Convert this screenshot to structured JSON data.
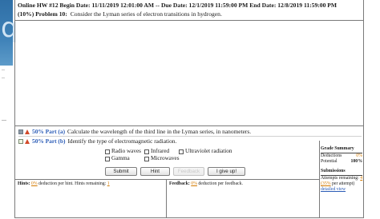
{
  "header": {
    "title_line": "Online HW #12 Begin Date: 11/11/2019 12:01:00 AM -- Due Date: 12/1/2019 11:59:00 PM End Date: 12/8/2019 11:59:00 PM",
    "problem_pct": "(10%)",
    "problem_label": "Problem 10:",
    "problem_text": "Consider the Lyman series of electron transitions in hydrogen."
  },
  "parts": [
    {
      "tag": "50% Part (a)",
      "text": "Calculate the wavelength of the third line in the Lyman series, in nanometers."
    },
    {
      "tag": "50% Part (b)",
      "text": "Identify the type of electromagnetic radiation."
    }
  ],
  "answers": [
    "Radio waves",
    "Infrared",
    "Ultraviolet radiation",
    "Gamma",
    "Microwaves"
  ],
  "buttons": {
    "submit": "Submit",
    "hint": "Hint",
    "feedback": "Feedback",
    "give_up": "I give up!"
  },
  "grade_summary": {
    "title": "Grade Summary",
    "deductions_label": "Deductions",
    "deductions_value": "0%",
    "potential_label": "Potential",
    "potential_value": "100%"
  },
  "submissions": {
    "title": "Submissions",
    "attempts_label": "Attempts remaining:",
    "attempts_value": "4",
    "per_attempt_pct": "(35%",
    "per_attempt_suffix": "per attempt)",
    "detailed_view": "detailed view"
  },
  "footer": {
    "hints_label": "Hints:",
    "hints_pct": "0%",
    "hints_text": "deduction per hint. Hints remaining:",
    "hints_remaining": "1",
    "feedback_label": "Feedback:",
    "feedback_pct": "0%",
    "feedback_text": "deduction per feedback."
  },
  "colors": {
    "accent_blue": "#2a5bb6",
    "orange": "#d47a00",
    "part_icon_red": "#d24a2a"
  }
}
